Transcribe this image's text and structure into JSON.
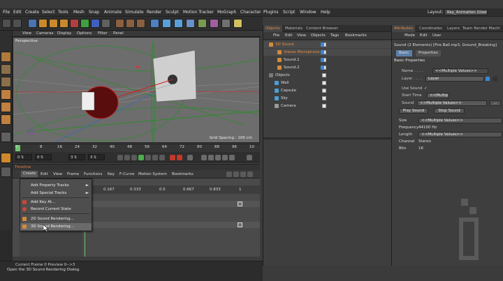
{
  "menubar": {
    "items": [
      "File",
      "Edit",
      "Create",
      "Select",
      "Tools",
      "Mesh",
      "Snap",
      "Animate",
      "Simulate",
      "Render",
      "Sculpt",
      "Motion Tracker",
      "MoGraph",
      "Character",
      "Plugins",
      "Script",
      "Window",
      "Help"
    ],
    "layout_label": "Layout:",
    "layout_value": "Key_Animation (User)"
  },
  "viewport": {
    "menu": [
      "View",
      "Cameras",
      "Display",
      "Options",
      "Filter",
      "Panel"
    ],
    "label": "Perspective",
    "grid_spacing": "Grid Spacing : 100 cm"
  },
  "ruler": {
    "ticks": [
      "0",
      "8",
      "16",
      "24",
      "32",
      "40",
      "48",
      "56",
      "64",
      "72",
      "80",
      "88",
      "96",
      "10"
    ]
  },
  "transport": {
    "start": "0 S",
    "current": "0 S",
    "end": "3 S",
    "max": "3 S"
  },
  "timeline": {
    "title": "Timeline",
    "menu": [
      "Create",
      "Edit",
      "View",
      "Frame",
      "Functions",
      "Key",
      "F-Curve",
      "Motion System",
      "Bookmarks"
    ],
    "ticks": [
      "0",
      "0.167",
      "0.333",
      "0.5",
      "0.667",
      "0.833",
      "1"
    ]
  },
  "dropdown": {
    "items": [
      {
        "label": "Add Property Tracks",
        "arrow": "►",
        "icon_color": ""
      },
      {
        "label": "Add Special Tracks",
        "arrow": "►",
        "icon_color": ""
      },
      {
        "label": "Add Key At...",
        "arrow": "",
        "icon_color": "#c9463a"
      },
      {
        "label": "Record Current State",
        "arrow": "",
        "icon_color": "#c9463a"
      },
      {
        "label": "2D Sound Rendering...",
        "arrow": "",
        "icon_color": "#d48a3a"
      },
      {
        "label": "3D Sound Rendering...",
        "arrow": "",
        "icon_color": "#d48a3a"
      }
    ]
  },
  "status": {
    "current_frame": "Current Frame  0   Preview  0-->3",
    "message": "Open the 3D Sound Rendering Dialog."
  },
  "objects_panel": {
    "tabs": [
      "Objects",
      "Materials",
      "Content Browser"
    ],
    "menu": [
      "File",
      "Edit",
      "View",
      "Objects",
      "Tags",
      "Bookmarks"
    ],
    "rows": [
      {
        "name": "3D Sound",
        "indent": 8,
        "color": "#e88d45",
        "icon": "#d48a3a",
        "selected": true
      },
      {
        "name": "Stereo Microphone",
        "indent": 20,
        "color": "#e88d45",
        "icon": "#d48a3a",
        "selected": true
      },
      {
        "name": "Sound.1",
        "indent": 20,
        "color": "#dddddd",
        "icon": "#d48a3a",
        "selected": false
      },
      {
        "name": "Sound.2",
        "indent": 20,
        "color": "#dddddd",
        "icon": "#d48a3a",
        "selected": false
      },
      {
        "name": "Objects",
        "indent": 8,
        "color": "#dddddd",
        "icon": "#7a7a7a",
        "selected": false
      },
      {
        "name": "Wall",
        "indent": 16,
        "color": "#dddddd",
        "icon": "#4aa0d8",
        "selected": false
      },
      {
        "name": "Capsule",
        "indent": 16,
        "color": "#dddddd",
        "icon": "#4aa0d8",
        "selected": false
      },
      {
        "name": "Sky",
        "indent": 16,
        "color": "#dddddd",
        "icon": "#4aa0d8",
        "selected": false
      },
      {
        "name": "Camera",
        "indent": 16,
        "color": "#dddddd",
        "icon": "#9a9a9a",
        "selected": false
      }
    ]
  },
  "attributes_panel": {
    "tabs": [
      "Attributes",
      "Coordinates",
      "Layers",
      "Team Render Machi"
    ],
    "menu": [
      "Mode",
      "Edit",
      "User"
    ],
    "title": "Sound (2 Elements) [Fire Ball.mp3, Ground_Breaking]",
    "subtabs": [
      "Basic",
      "Properties"
    ],
    "section": "Basic Properties",
    "name_label": "Name . . . .",
    "name_value": "<<Multiple Values>>",
    "layer_label": "Layer . . . .",
    "layer_value": "Layer",
    "use_sound_label": "Use Sound",
    "use_sound_check": "✓",
    "start_time_label": "Start Time",
    "start_time_value": "<<Multip",
    "sound_label": "Sound",
    "sound_value": "<<Multiple Values>>",
    "sound_browse": "...",
    "play_button": "Play Sound",
    "stop_button": "Stop Sound",
    "size_label": "Size",
    "size_value": "<<Multiple Values>>",
    "frequency_label": "Frequency",
    "frequency_value": "44100 Hz",
    "length_label": "Length",
    "length_value": "<<Multiple Values>>",
    "channel_label": "Channel",
    "channel_value": "Stereo",
    "bits_label": "Bits",
    "bits_value": "16"
  },
  "colors": {
    "accent": "#e88d45",
    "key_green": "#6ec46e",
    "selection_blue": "#3a87d6"
  }
}
